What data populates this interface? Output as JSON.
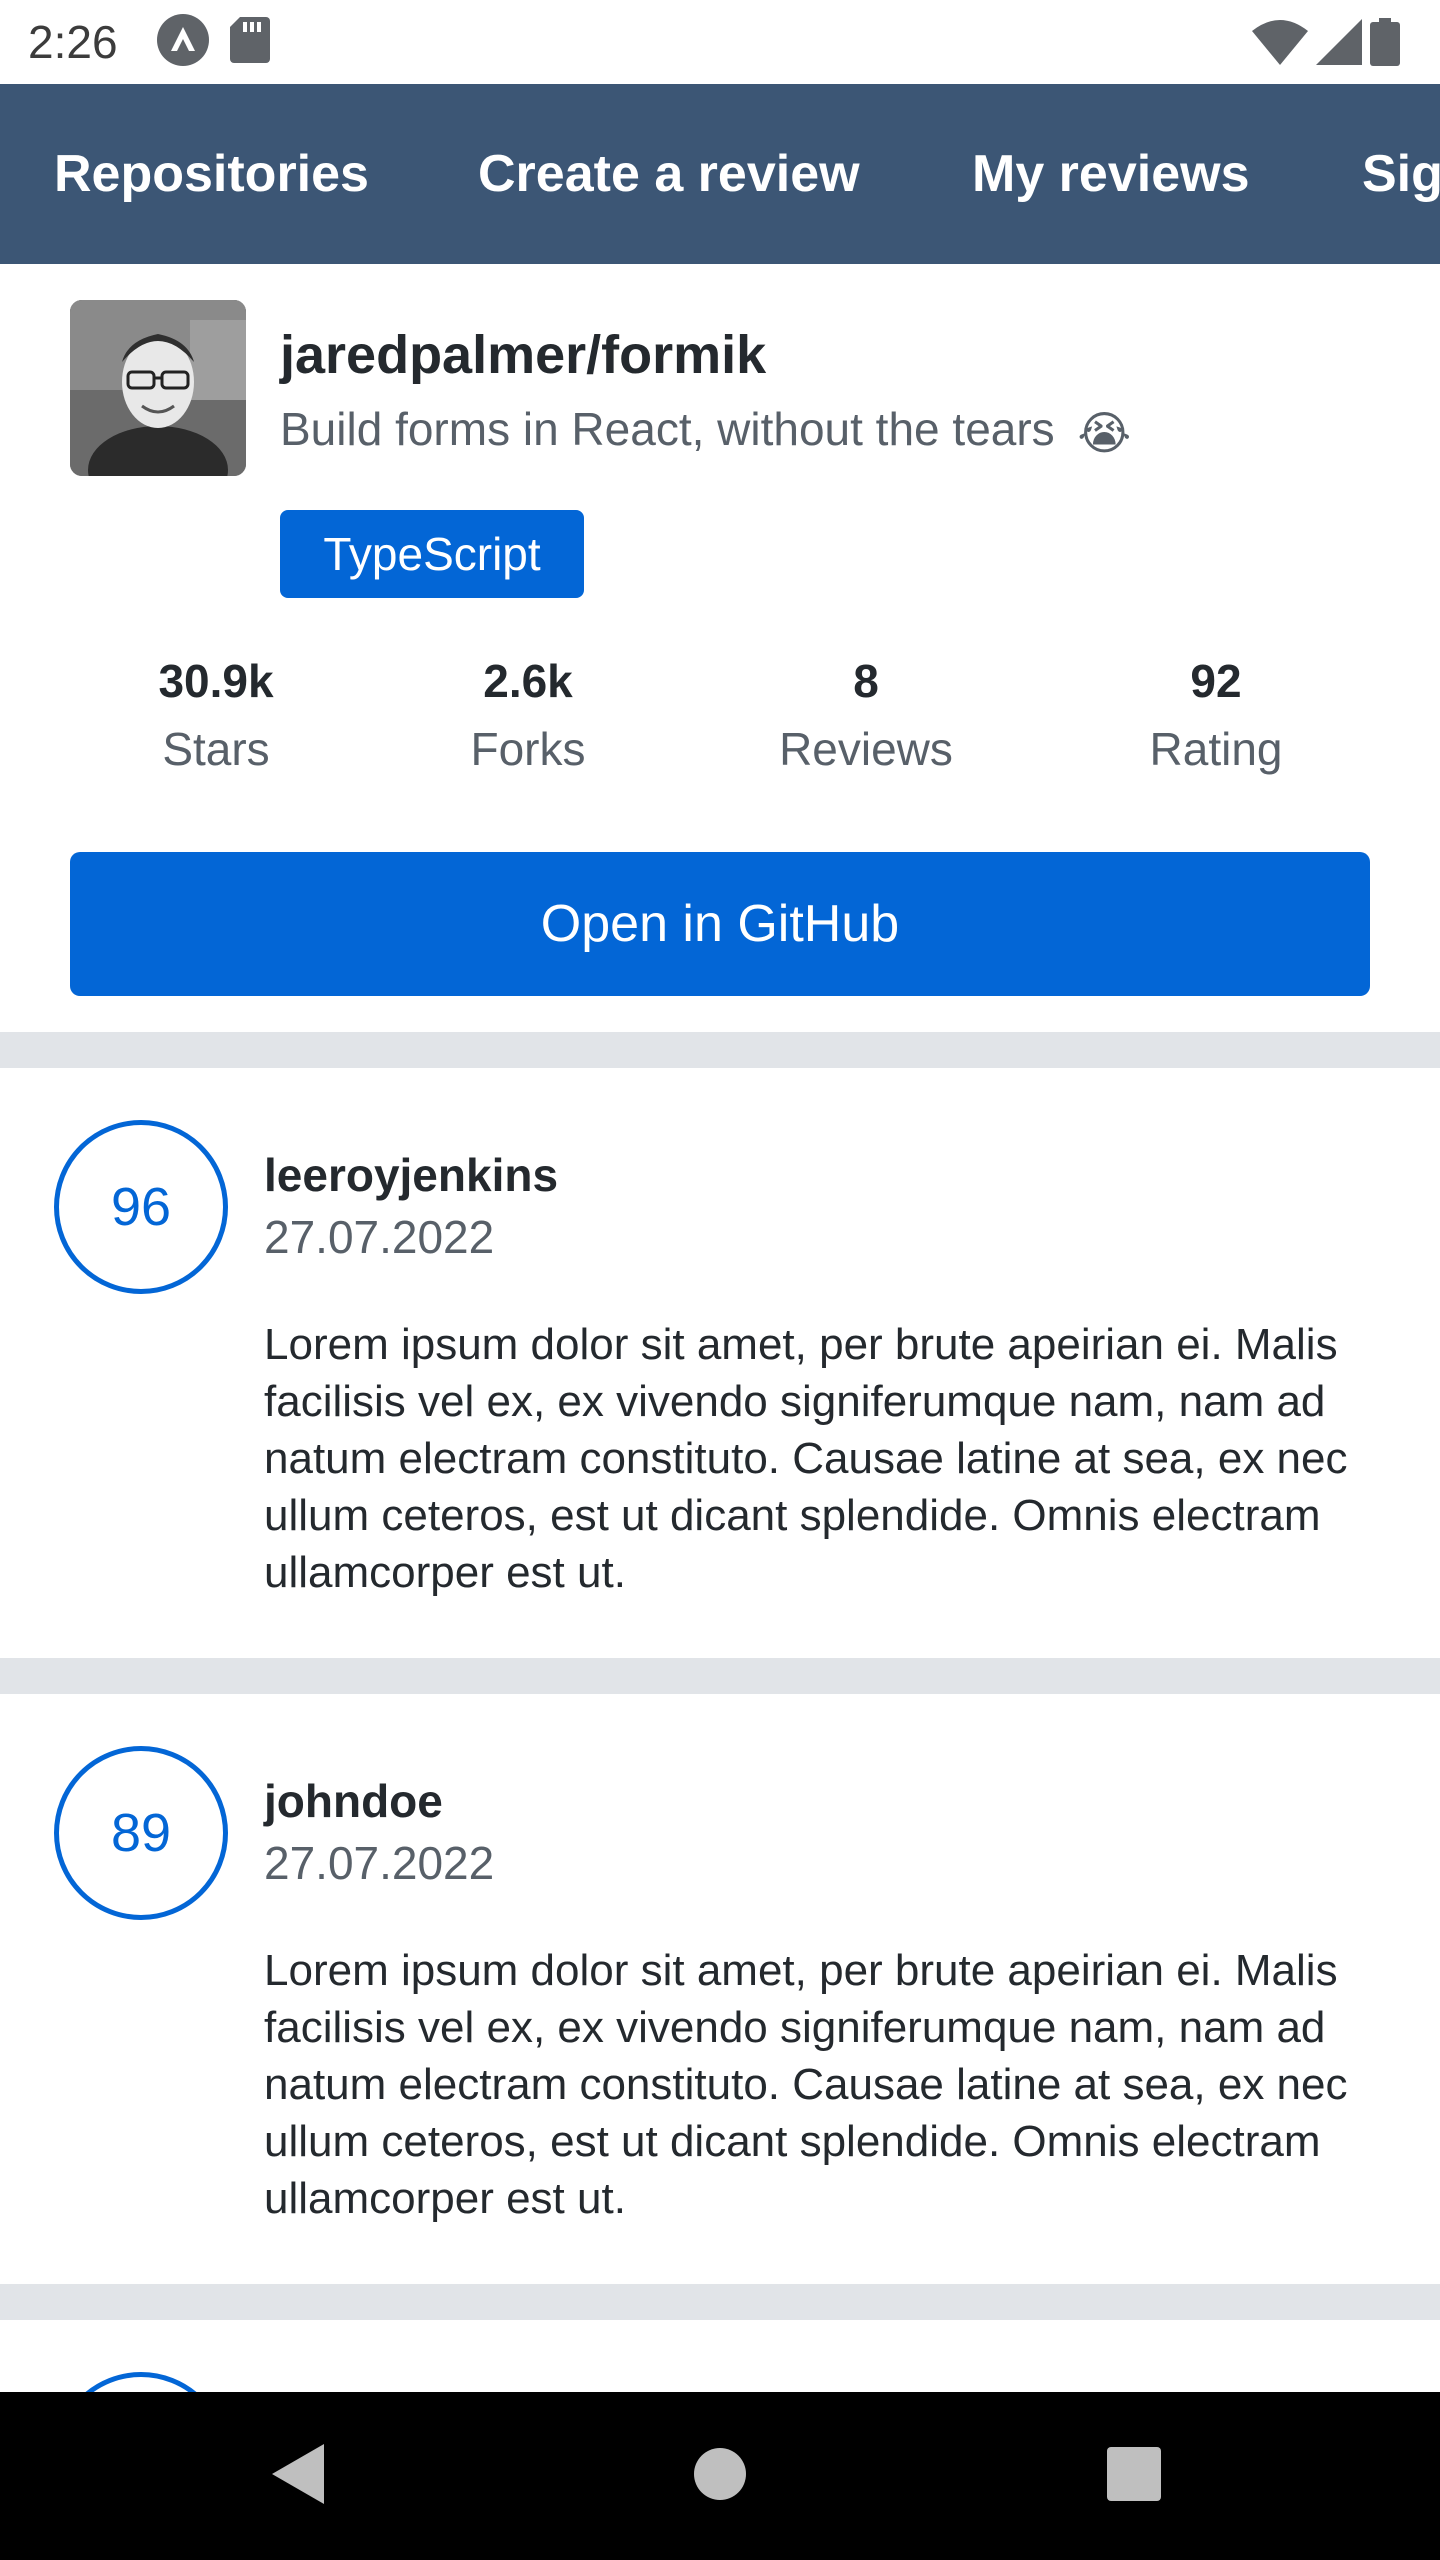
{
  "status_bar": {
    "time": "2:26",
    "icons": [
      "app-notification-icon",
      "sd-card-icon",
      "wifi-icon",
      "signal-icon",
      "battery-icon"
    ]
  },
  "tabs": [
    {
      "label": "Repositories"
    },
    {
      "label": "Create a review"
    },
    {
      "label": "My reviews"
    },
    {
      "label": "Sig"
    }
  ],
  "repository": {
    "full_name": "jaredpalmer/formik",
    "description": "Build forms in React, without the tears",
    "description_emoji": "😭",
    "language": "TypeScript",
    "stats": [
      {
        "value": "30.9k",
        "label": "Stars"
      },
      {
        "value": "2.6k",
        "label": "Forks"
      },
      {
        "value": "8",
        "label": "Reviews"
      },
      {
        "value": "92",
        "label": "Rating"
      }
    ],
    "open_button_label": "Open in GitHub"
  },
  "reviews": [
    {
      "rating": "96",
      "username": "leeroyjenkins",
      "date": "27.07.2022",
      "text": "Lorem ipsum dolor sit amet, per brute apeirian ei. Malis facilisis vel ex, ex vivendo signiferumque nam, nam ad natum electram constituto. Causae latine at sea, ex nec ullum ceteros, est ut dicant splendide. Omnis electram ullamcorper est ut."
    },
    {
      "rating": "89",
      "username": "johndoe",
      "date": "27.07.2022",
      "text": "Lorem ipsum dolor sit amet, per brute apeirian ei. Malis facilisis vel ex, ex vivendo signiferumque nam, nam ad natum electram constituto. Causae latine at sea, ex nec ullum ceteros, est ut dicant splendide. Omnis electram ullamcorper est ut."
    }
  ],
  "colors": {
    "app_bar": "#3c5675",
    "primary": "#0366d6",
    "separator": "#e1e4e8",
    "text_primary": "#24292e",
    "text_secondary": "#586069"
  }
}
